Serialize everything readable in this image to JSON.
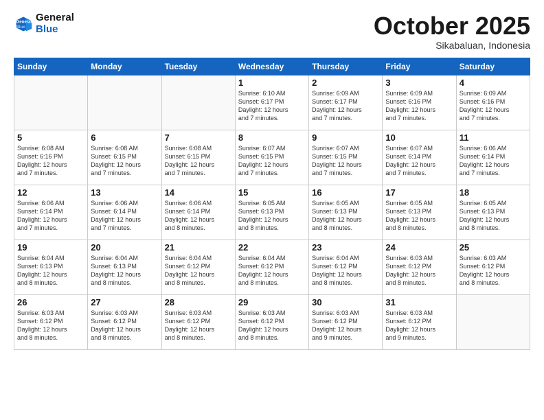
{
  "header": {
    "logo_line1": "General",
    "logo_line2": "Blue",
    "month": "October 2025",
    "location": "Sikabaluan, Indonesia"
  },
  "weekdays": [
    "Sunday",
    "Monday",
    "Tuesday",
    "Wednesday",
    "Thursday",
    "Friday",
    "Saturday"
  ],
  "weeks": [
    [
      {
        "day": "",
        "info": ""
      },
      {
        "day": "",
        "info": ""
      },
      {
        "day": "",
        "info": ""
      },
      {
        "day": "1",
        "info": "Sunrise: 6:10 AM\nSunset: 6:17 PM\nDaylight: 12 hours\nand 7 minutes."
      },
      {
        "day": "2",
        "info": "Sunrise: 6:09 AM\nSunset: 6:17 PM\nDaylight: 12 hours\nand 7 minutes."
      },
      {
        "day": "3",
        "info": "Sunrise: 6:09 AM\nSunset: 6:16 PM\nDaylight: 12 hours\nand 7 minutes."
      },
      {
        "day": "4",
        "info": "Sunrise: 6:09 AM\nSunset: 6:16 PM\nDaylight: 12 hours\nand 7 minutes."
      }
    ],
    [
      {
        "day": "5",
        "info": "Sunrise: 6:08 AM\nSunset: 6:16 PM\nDaylight: 12 hours\nand 7 minutes."
      },
      {
        "day": "6",
        "info": "Sunrise: 6:08 AM\nSunset: 6:15 PM\nDaylight: 12 hours\nand 7 minutes."
      },
      {
        "day": "7",
        "info": "Sunrise: 6:08 AM\nSunset: 6:15 PM\nDaylight: 12 hours\nand 7 minutes."
      },
      {
        "day": "8",
        "info": "Sunrise: 6:07 AM\nSunset: 6:15 PM\nDaylight: 12 hours\nand 7 minutes."
      },
      {
        "day": "9",
        "info": "Sunrise: 6:07 AM\nSunset: 6:15 PM\nDaylight: 12 hours\nand 7 minutes."
      },
      {
        "day": "10",
        "info": "Sunrise: 6:07 AM\nSunset: 6:14 PM\nDaylight: 12 hours\nand 7 minutes."
      },
      {
        "day": "11",
        "info": "Sunrise: 6:06 AM\nSunset: 6:14 PM\nDaylight: 12 hours\nand 7 minutes."
      }
    ],
    [
      {
        "day": "12",
        "info": "Sunrise: 6:06 AM\nSunset: 6:14 PM\nDaylight: 12 hours\nand 7 minutes."
      },
      {
        "day": "13",
        "info": "Sunrise: 6:06 AM\nSunset: 6:14 PM\nDaylight: 12 hours\nand 7 minutes."
      },
      {
        "day": "14",
        "info": "Sunrise: 6:06 AM\nSunset: 6:14 PM\nDaylight: 12 hours\nand 8 minutes."
      },
      {
        "day": "15",
        "info": "Sunrise: 6:05 AM\nSunset: 6:13 PM\nDaylight: 12 hours\nand 8 minutes."
      },
      {
        "day": "16",
        "info": "Sunrise: 6:05 AM\nSunset: 6:13 PM\nDaylight: 12 hours\nand 8 minutes."
      },
      {
        "day": "17",
        "info": "Sunrise: 6:05 AM\nSunset: 6:13 PM\nDaylight: 12 hours\nand 8 minutes."
      },
      {
        "day": "18",
        "info": "Sunrise: 6:05 AM\nSunset: 6:13 PM\nDaylight: 12 hours\nand 8 minutes."
      }
    ],
    [
      {
        "day": "19",
        "info": "Sunrise: 6:04 AM\nSunset: 6:13 PM\nDaylight: 12 hours\nand 8 minutes."
      },
      {
        "day": "20",
        "info": "Sunrise: 6:04 AM\nSunset: 6:13 PM\nDaylight: 12 hours\nand 8 minutes."
      },
      {
        "day": "21",
        "info": "Sunrise: 6:04 AM\nSunset: 6:12 PM\nDaylight: 12 hours\nand 8 minutes."
      },
      {
        "day": "22",
        "info": "Sunrise: 6:04 AM\nSunset: 6:12 PM\nDaylight: 12 hours\nand 8 minutes."
      },
      {
        "day": "23",
        "info": "Sunrise: 6:04 AM\nSunset: 6:12 PM\nDaylight: 12 hours\nand 8 minutes."
      },
      {
        "day": "24",
        "info": "Sunrise: 6:03 AM\nSunset: 6:12 PM\nDaylight: 12 hours\nand 8 minutes."
      },
      {
        "day": "25",
        "info": "Sunrise: 6:03 AM\nSunset: 6:12 PM\nDaylight: 12 hours\nand 8 minutes."
      }
    ],
    [
      {
        "day": "26",
        "info": "Sunrise: 6:03 AM\nSunset: 6:12 PM\nDaylight: 12 hours\nand 8 minutes."
      },
      {
        "day": "27",
        "info": "Sunrise: 6:03 AM\nSunset: 6:12 PM\nDaylight: 12 hours\nand 8 minutes."
      },
      {
        "day": "28",
        "info": "Sunrise: 6:03 AM\nSunset: 6:12 PM\nDaylight: 12 hours\nand 8 minutes."
      },
      {
        "day": "29",
        "info": "Sunrise: 6:03 AM\nSunset: 6:12 PM\nDaylight: 12 hours\nand 8 minutes."
      },
      {
        "day": "30",
        "info": "Sunrise: 6:03 AM\nSunset: 6:12 PM\nDaylight: 12 hours\nand 9 minutes."
      },
      {
        "day": "31",
        "info": "Sunrise: 6:03 AM\nSunset: 6:12 PM\nDaylight: 12 hours\nand 9 minutes."
      },
      {
        "day": "",
        "info": ""
      }
    ]
  ]
}
